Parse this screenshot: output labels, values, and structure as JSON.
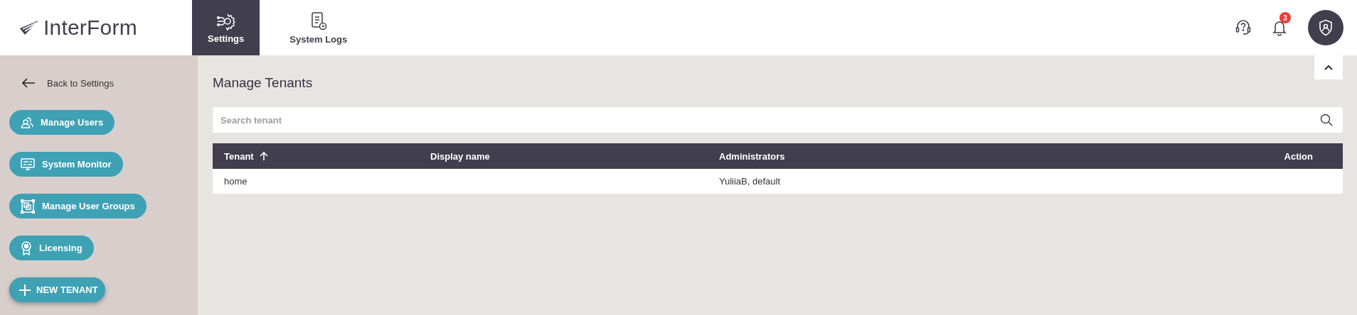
{
  "header": {
    "logo": "InterForm",
    "tabs": [
      {
        "label": "Settings",
        "selected": true
      },
      {
        "label": "System Logs",
        "selected": false
      }
    ],
    "notifications": {
      "count": "3"
    }
  },
  "sidebar": {
    "back": "Back to Settings",
    "items": [
      {
        "label": "Manage Users"
      },
      {
        "label": "System Monitor"
      },
      {
        "label": "Manage User Groups"
      },
      {
        "label": "Licensing"
      }
    ],
    "new_button": "NEW TENANT"
  },
  "main": {
    "title": "Manage Tenants",
    "search": {
      "placeholder": "Search tenant"
    },
    "table": {
      "columns": [
        {
          "label": "Tenant",
          "sorted": true
        },
        {
          "label": "Display name"
        },
        {
          "label": "Administrators"
        },
        {
          "label": "Action"
        }
      ],
      "rows": [
        {
          "tenant": "home",
          "administrators": "YuliiaB, default"
        }
      ]
    }
  }
}
